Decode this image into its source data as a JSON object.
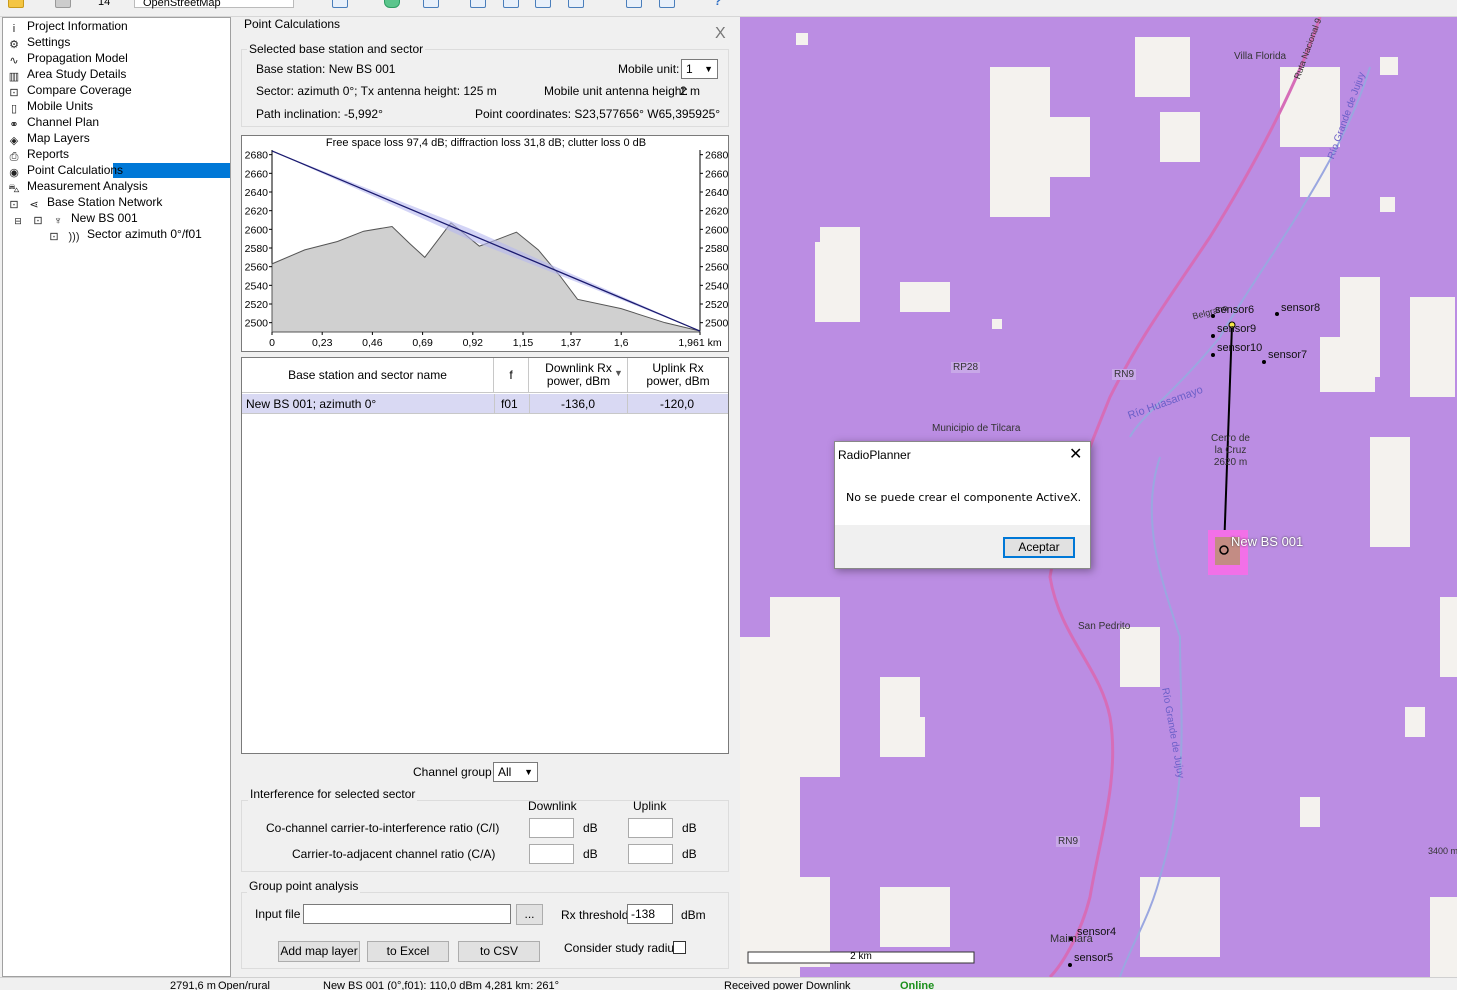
{
  "toolbar": {
    "zoom": "14",
    "map_source": "OpenStreetMap"
  },
  "tree": {
    "items": [
      {
        "label": "Project Information",
        "icon": "info-icon"
      },
      {
        "label": "Settings",
        "icon": "gear-icon"
      },
      {
        "label": "Propagation Model",
        "icon": "wave-icon"
      },
      {
        "label": "Area Study Details",
        "icon": "bar-chart-icon"
      },
      {
        "label": "Compare Coverage",
        "icon": "compare-icon"
      },
      {
        "label": "Mobile Units",
        "icon": "phone-icon"
      },
      {
        "label": "Channel Plan",
        "icon": "network-icon"
      },
      {
        "label": "Map Layers",
        "icon": "layers-icon"
      },
      {
        "label": "Reports",
        "icon": "printer-icon"
      },
      {
        "label": "Point Calculations",
        "icon": "pin-icon"
      },
      {
        "label": "Measurement Analysis",
        "icon": "car-icon"
      },
      {
        "label": "Base Station Network",
        "icon": "share-icon"
      },
      {
        "label": "New BS 001",
        "icon": "antenna-icon"
      },
      {
        "label": "Sector azimuth 0°/f01",
        "icon": "signal-icon"
      }
    ]
  },
  "panel": {
    "title": "Point Calculations",
    "close": "X",
    "selected_group": "Selected base station and sector",
    "base_station": "Base station: New BS 001",
    "mobile_unit_label": "Mobile unit:",
    "mobile_unit_value": "1",
    "sector": "Sector: azimuth 0°; Tx antenna height: 125 m",
    "mobile_height_label": "Mobile unit antenna height:",
    "mobile_height_value": "2 m",
    "path_inclination": "Path inclination: -5,992°",
    "point_coordinates": "Point coordinates: S23,577656°  W65,395925°",
    "channel_group_label": "Channel group",
    "channel_group_value": "All",
    "interference_group": "Interference for selected sector",
    "downlink": "Downlink",
    "uplink": "Uplink",
    "ci_label": "Co-channel carrier-to-interference ratio (C/I)",
    "ca_label": "Carrier-to-adjacent channel ratio (C/A)",
    "db": "dB",
    "group_analysis": "Group point analysis",
    "input_file_label": "Input file",
    "browse": "...",
    "rx_threshold_label": "Rx threshold",
    "rx_threshold_value": "-138",
    "dbm": "dBm",
    "add_map_layer": "Add map layer",
    "to_excel": "to Excel",
    "to_csv": "to CSV",
    "consider_radius": "Consider study radius"
  },
  "table": {
    "headers": [
      "Base station and sector name",
      "f",
      "Downlink Rx\npower, dBm",
      "Uplink Rx\npower, dBm"
    ],
    "rows": [
      [
        "New BS 001; azimuth 0°",
        "f01",
        "-136,0",
        "-120,0"
      ]
    ]
  },
  "chart_data": {
    "type": "area",
    "title": "Free space  loss 97,4 dB; diffraction  loss 31,8 dB; clutter  loss 0 dB",
    "x_unit": "km",
    "xlim": [
      0,
      1.961
    ],
    "ylim": [
      2490,
      2685
    ],
    "x_ticks": [
      "0",
      "0,23",
      "0,46",
      "0,69",
      "0,92",
      "1,15",
      "1,37",
      "1,6",
      "1,961"
    ],
    "y_ticks": [
      "2680",
      "2660",
      "2640",
      "2620",
      "2600",
      "2580",
      "2560",
      "2540",
      "2520",
      "2500"
    ],
    "terrain": {
      "x": [
        0,
        0.15,
        0.3,
        0.42,
        0.55,
        0.63,
        0.7,
        0.82,
        0.95,
        1.02,
        1.12,
        1.22,
        1.32,
        1.4,
        1.6,
        1.8,
        1.961
      ],
      "y": [
        2563,
        2578,
        2587,
        2598,
        2603,
        2585,
        2570,
        2607,
        2582,
        2588,
        2597,
        2578,
        2550,
        2525,
        2515,
        2500,
        2491
      ]
    },
    "line_of_sight": {
      "x": [
        0,
        1.961
      ],
      "y": [
        2684,
        2491
      ]
    },
    "colors": {
      "terrain": "#d0d0d0",
      "los": "#1a1a6e",
      "fresnel": "#b5b8f0"
    }
  },
  "map": {
    "scale_label": "2 km",
    "place_labels": [
      "Villa Florida",
      "Ruta Nacional 9",
      "Río Grande de Jujuy",
      "RP28",
      "RN9",
      "Río Huasamayo",
      "Municipio de Tilcara",
      "Cerro de la Cruz 2620 m",
      "San Pedrito",
      "Río Grande de Jujuy",
      "RN9",
      "Maimará",
      "3400 m",
      "Belgrano"
    ],
    "sensors": [
      "sensor6",
      "sensor8",
      "sensor9",
      "sensor10",
      "sensor7",
      "sensor4",
      "sensor5"
    ],
    "base_station": "New BS 001"
  },
  "dialog": {
    "title": "RadioPlanner",
    "message": "No se puede crear el componente ActiveX.",
    "ok": "Aceptar"
  },
  "status": {
    "cell1": "2791,6 m",
    "cell2": "Open/rural",
    "cell3": "New BS 001 (0°,f01): 110,0 dBm 4,281 km: 261°",
    "cell4": "Received power Downlink",
    "cell5": "Online"
  }
}
